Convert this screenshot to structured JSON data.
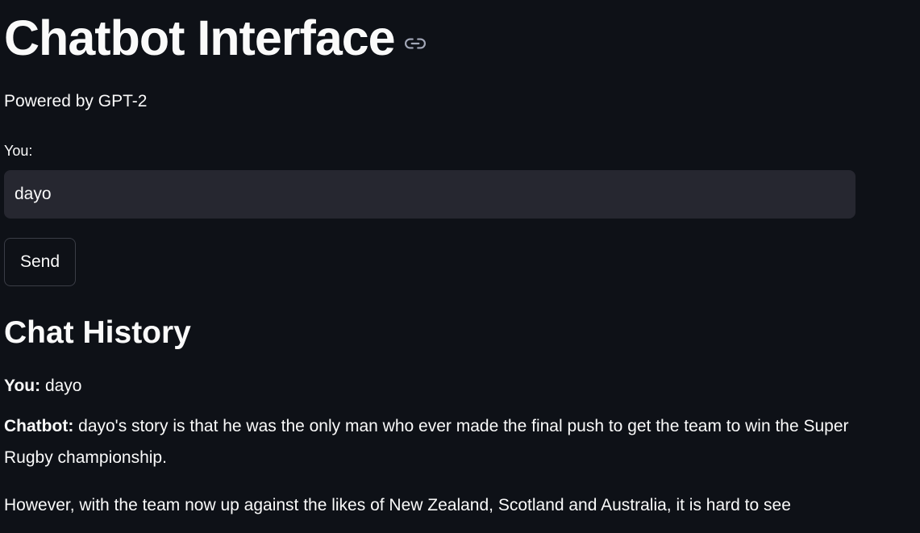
{
  "header": {
    "title": "Chatbot Interface",
    "link_icon": "link-icon"
  },
  "subtitle": "Powered by GPT-2",
  "input": {
    "label": "You:",
    "value": "dayo"
  },
  "send_button": {
    "label": "Send"
  },
  "history": {
    "heading": "Chat History",
    "messages": [
      {
        "speaker": "You:",
        "text": " dayo"
      },
      {
        "speaker": "Chatbot:",
        "text": " dayo's story is that he was the only man who ever made the final push to get the team to win the Super Rugby championship."
      }
    ],
    "continuation": "However, with the team now up against the likes of New Zealand, Scotland and Australia, it is hard to see"
  },
  "colors": {
    "background": "#0e1117",
    "text": "#fafafa",
    "input_background": "#262730",
    "button_border": "#3a3d46"
  }
}
